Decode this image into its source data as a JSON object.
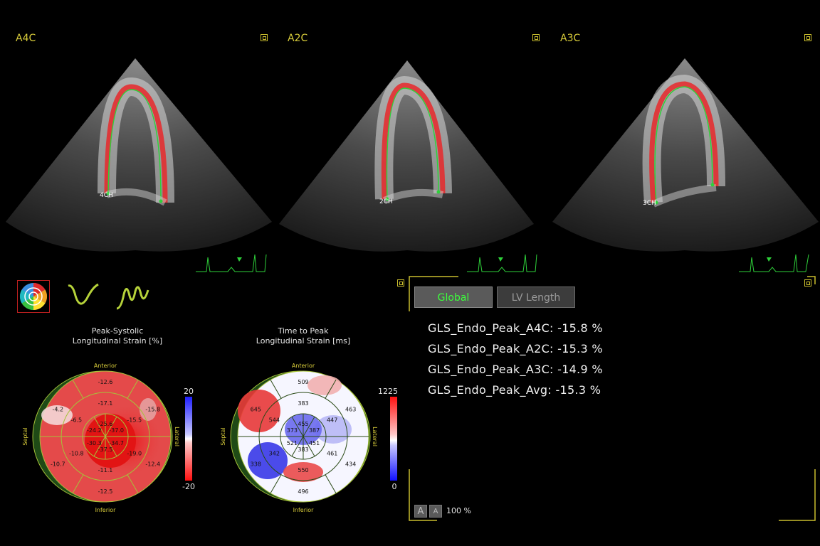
{
  "views": [
    {
      "label": "A4C",
      "tag": "4CH"
    },
    {
      "label": "A2C",
      "tag": "2CH"
    },
    {
      "label": "A3C",
      "tag": "3CH"
    }
  ],
  "strain_map": {
    "title_line1": "Peak-Systolic",
    "title_line2": "Longitudinal Strain [%]",
    "scale_max": "20",
    "scale_min": "-20",
    "labels": {
      "top": "Anterior",
      "bottom": "Inferior",
      "left": "Septal",
      "right": "Lateral"
    },
    "outer": [
      "-12.6",
      "-15.8",
      "-12.4",
      "-12.5",
      "-10.7",
      "-4.2"
    ],
    "mid": [
      "-17.1",
      "-15.5",
      "-19.0",
      "-11.1",
      "-10.8",
      "-6.5"
    ],
    "inner": [
      "-25.6",
      "-37.0",
      "-34.7",
      "-37.5",
      "-30.3",
      "-24.2"
    ]
  },
  "ttp_map": {
    "title_line1": "Time to Peak",
    "title_line2": "Longitudinal Strain [ms]",
    "scale_max": "1225",
    "scale_min": "0",
    "labels": {
      "top": "Anterior",
      "bottom": "Inferior",
      "left": "Septal",
      "right": "Lateral"
    },
    "outer": [
      "509",
      "463",
      "434",
      "496",
      "338",
      "645"
    ],
    "mid": [
      "383",
      "447",
      "461",
      "550",
      "342",
      "544"
    ],
    "inner": [
      "455",
      "387",
      "451",
      "383",
      "521",
      "373"
    ]
  },
  "results": {
    "tabs": [
      {
        "label": "Global",
        "active": true
      },
      {
        "label": "LV Length",
        "active": false
      }
    ],
    "lines": [
      "GLS_Endo_Peak_A4C: -15.8 %",
      "GLS_Endo_Peak_A2C: -15.3 %",
      "GLS_Endo_Peak_A3C: -14.9 %",
      "GLS_Endo_Peak_Avg: -15.3 %"
    ],
    "zoom_a_large": "A",
    "zoom_a_small": "A",
    "zoom_level": "100 %"
  },
  "colors": {
    "accent": "#d8cc3a",
    "tab_active_text": "#3cff3c",
    "strain_red": "#e8282a",
    "trace_green": "#2ed13a"
  },
  "icons": [
    "bullseye-icon",
    "strain-curve-icon",
    "multi-curve-icon",
    "maximize-icon"
  ]
}
